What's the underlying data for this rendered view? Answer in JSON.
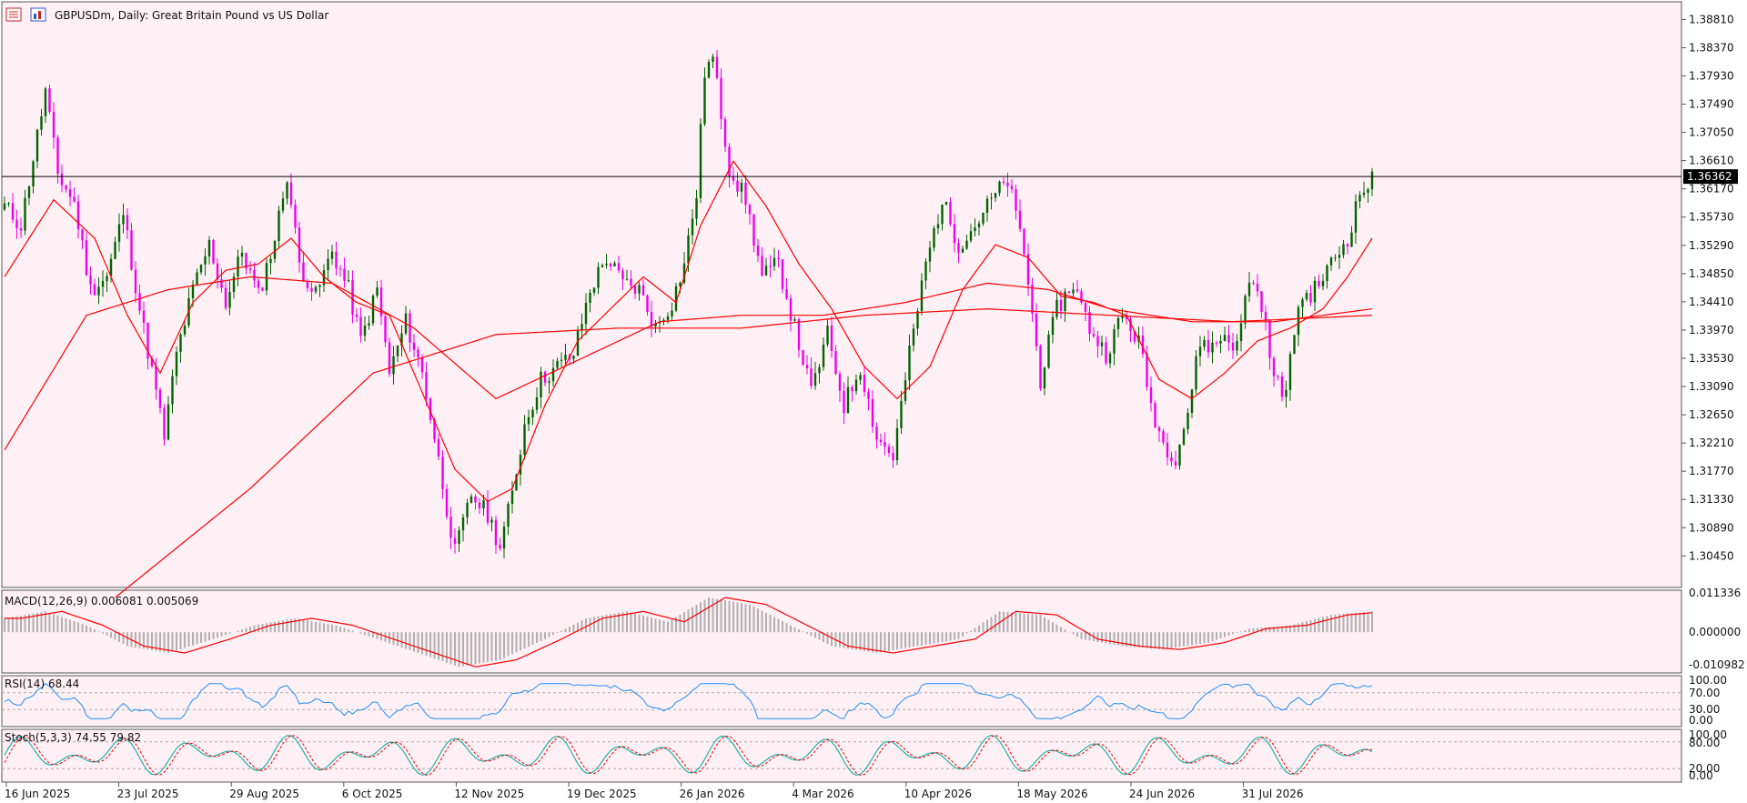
{
  "colors": {
    "background": "#fff0f5",
    "bull": "#006400",
    "bear": "#ee00ee",
    "ma": "#ff0000",
    "rsi": "#1e90ff",
    "stoch_main": "#20b2aa",
    "stoch_signal": "#ff0000",
    "macd_hist": "#b0b0b0",
    "price_tag_bg": "#000000"
  },
  "header": {
    "symbol": "GBPUSDm, Daily:",
    "description": "Great Britain Pound vs US Dollar"
  },
  "toolbar": {
    "icons": [
      "chart-grid-icon",
      "chart-bars-icon"
    ]
  },
  "main_chart": {
    "current_price": "1.36362",
    "y_ticks": [
      "1.38810",
      "1.38370",
      "1.37930",
      "1.37490",
      "1.37050",
      "1.36610",
      "1.36170",
      "1.35730",
      "1.35290",
      "1.34850",
      "1.34410",
      "1.33970",
      "1.33530",
      "1.33090",
      "1.32650",
      "1.32210",
      "1.31770",
      "1.31330",
      "1.30890",
      "1.30450"
    ]
  },
  "macd": {
    "label": "MACD(12,26,9) 0.006081 0.005069",
    "y_ticks": [
      "0.011336",
      "0.000000",
      "-0.010982"
    ]
  },
  "rsi": {
    "label": "RSI(14) 68.44",
    "y_ticks": [
      "100.00",
      "70.00",
      "30.00",
      "0.00"
    ]
  },
  "stoch": {
    "label": "Stoch(5,3,3) 74.55 79.82",
    "y_ticks": [
      "100.00",
      "80.00",
      "20.00",
      "0.00"
    ]
  },
  "x_labels": [
    "16 Jun 2025",
    "23 Jul 2025",
    "29 Aug 2025",
    "6 Oct 2025",
    "12 Nov 2025",
    "19 Dec 2025",
    "26 Jan 2026",
    "4 Mar 2026",
    "10 Apr 2026",
    "18 May 2026",
    "24 Jun 2026",
    "31 Jul 2026"
  ],
  "chart_data": {
    "type": "candlestick",
    "symbol": "GBPUSDm",
    "timeframe": "Daily",
    "y_range": [
      1.301,
      1.39
    ],
    "current_price": 1.36362,
    "anchors": [
      [
        0,
        1.359
      ],
      [
        4,
        1.356
      ],
      [
        8,
        1.37
      ],
      [
        10,
        1.377
      ],
      [
        13,
        1.364
      ],
      [
        17,
        1.3595
      ],
      [
        21,
        1.346
      ],
      [
        25,
        1.348
      ],
      [
        29,
        1.358
      ],
      [
        33,
        1.343
      ],
      [
        37,
        1.33
      ],
      [
        39,
        1.323
      ],
      [
        42,
        1.336
      ],
      [
        46,
        1.346
      ],
      [
        50,
        1.353
      ],
      [
        54,
        1.344
      ],
      [
        58,
        1.352
      ],
      [
        62,
        1.345
      ],
      [
        66,
        1.354
      ],
      [
        69,
        1.364
      ],
      [
        72,
        1.35
      ],
      [
        76,
        1.345
      ],
      [
        80,
        1.352
      ],
      [
        84,
        1.346
      ],
      [
        87,
        1.338
      ],
      [
        91,
        1.346
      ],
      [
        94,
        1.333
      ],
      [
        98,
        1.341
      ],
      [
        102,
        1.333
      ],
      [
        105,
        1.323
      ],
      [
        108,
        1.312
      ],
      [
        110,
        1.305
      ],
      [
        114,
        1.314
      ],
      [
        118,
        1.311
      ],
      [
        121,
        1.306
      ],
      [
        124,
        1.314
      ],
      [
        127,
        1.325
      ],
      [
        131,
        1.332
      ],
      [
        135,
        1.334
      ],
      [
        139,
        1.336
      ],
      [
        143,
        1.346
      ],
      [
        147,
        1.351
      ],
      [
        151,
        1.347
      ],
      [
        155,
        1.346
      ],
      [
        159,
        1.34
      ],
      [
        163,
        1.344
      ],
      [
        166,
        1.35
      ],
      [
        169,
        1.361
      ],
      [
        171,
        1.38
      ],
      [
        173,
        1.382
      ],
      [
        177,
        1.365
      ],
      [
        181,
        1.36
      ],
      [
        185,
        1.348
      ],
      [
        189,
        1.35
      ],
      [
        193,
        1.34
      ],
      [
        197,
        1.33
      ],
      [
        201,
        1.339
      ],
      [
        205,
        1.328
      ],
      [
        209,
        1.334
      ],
      [
        213,
        1.323
      ],
      [
        217,
        1.32
      ],
      [
        221,
        1.336
      ],
      [
        225,
        1.35
      ],
      [
        229,
        1.36
      ],
      [
        233,
        1.353
      ],
      [
        237,
        1.356
      ],
      [
        241,
        1.36
      ],
      [
        245,
        1.363
      ],
      [
        249,
        1.352
      ],
      [
        253,
        1.332
      ],
      [
        257,
        1.343
      ],
      [
        261,
        1.347
      ],
      [
        265,
        1.34
      ],
      [
        269,
        1.336
      ],
      [
        273,
        1.342
      ],
      [
        277,
        1.338
      ],
      [
        280,
        1.328
      ],
      [
        283,
        1.322
      ],
      [
        286,
        1.32
      ],
      [
        289,
        1.327
      ],
      [
        292,
        1.338
      ],
      [
        295,
        1.337
      ],
      [
        298,
        1.339
      ],
      [
        301,
        1.337
      ],
      [
        304,
        1.348
      ],
      [
        307,
        1.344
      ],
      [
        310,
        1.332
      ],
      [
        313,
        1.33
      ],
      [
        316,
        1.344
      ],
      [
        320,
        1.346
      ],
      [
        324,
        1.35
      ],
      [
        328,
        1.354
      ],
      [
        331,
        1.361
      ],
      [
        334,
        1.363
      ]
    ],
    "ma_fast_anchors": [
      [
        0,
        1.348
      ],
      [
        12,
        1.36
      ],
      [
        22,
        1.354
      ],
      [
        30,
        1.342
      ],
      [
        38,
        1.333
      ],
      [
        46,
        1.344
      ],
      [
        54,
        1.349
      ],
      [
        62,
        1.35
      ],
      [
        70,
        1.354
      ],
      [
        78,
        1.348
      ],
      [
        86,
        1.344
      ],
      [
        94,
        1.342
      ],
      [
        102,
        1.33
      ],
      [
        110,
        1.318
      ],
      [
        118,
        1.313
      ],
      [
        124,
        1.315
      ],
      [
        132,
        1.328
      ],
      [
        140,
        1.338
      ],
      [
        148,
        1.343
      ],
      [
        156,
        1.348
      ],
      [
        164,
        1.344
      ],
      [
        170,
        1.356
      ],
      [
        178,
        1.366
      ],
      [
        186,
        1.359
      ],
      [
        194,
        1.35
      ],
      [
        202,
        1.343
      ],
      [
        210,
        1.334
      ],
      [
        218,
        1.329
      ],
      [
        226,
        1.334
      ],
      [
        234,
        1.346
      ],
      [
        242,
        1.353
      ],
      [
        250,
        1.351
      ],
      [
        258,
        1.345
      ],
      [
        266,
        1.344
      ],
      [
        274,
        1.342
      ],
      [
        282,
        1.332
      ],
      [
        290,
        1.329
      ],
      [
        298,
        1.333
      ],
      [
        306,
        1.338
      ],
      [
        314,
        1.34
      ],
      [
        322,
        1.343
      ],
      [
        328,
        1.348
      ],
      [
        334,
        1.354
      ]
    ],
    "ma_mid_anchors": [
      [
        0,
        1.321
      ],
      [
        20,
        1.342
      ],
      [
        40,
        1.346
      ],
      [
        60,
        1.348
      ],
      [
        80,
        1.347
      ],
      [
        100,
        1.34
      ],
      [
        120,
        1.329
      ],
      [
        140,
        1.335
      ],
      [
        160,
        1.341
      ],
      [
        180,
        1.342
      ],
      [
        200,
        1.342
      ],
      [
        220,
        1.344
      ],
      [
        240,
        1.347
      ],
      [
        255,
        1.346
      ],
      [
        270,
        1.343
      ],
      [
        290,
        1.341
      ],
      [
        310,
        1.341
      ],
      [
        334,
        1.343
      ]
    ],
    "ma_slow_anchors": [
      [
        27,
        1.298
      ],
      [
        60,
        1.315
      ],
      [
        90,
        1.333
      ],
      [
        120,
        1.339
      ],
      [
        150,
        1.34
      ],
      [
        180,
        1.34
      ],
      [
        210,
        1.342
      ],
      [
        240,
        1.343
      ],
      [
        270,
        1.342
      ],
      [
        300,
        1.341
      ],
      [
        334,
        1.342
      ]
    ],
    "macd": {
      "hist": [
        0.004,
        0.006,
        0.002,
        -0.004,
        -0.006,
        -0.002,
        0.002,
        0.004,
        0.002,
        -0.002,
        -0.006,
        -0.01,
        -0.008,
        -0.002,
        0.004,
        0.006,
        0.003,
        0.01,
        0.008,
        0.002,
        -0.004,
        -0.006,
        -0.004,
        -0.002,
        0.006,
        0.005,
        -0.002,
        -0.004,
        -0.005,
        -0.003,
        0.001,
        0.002,
        0.005,
        0.006
      ]
    },
    "rsi": {
      "levels": [
        30,
        70
      ]
    },
    "stoch": {
      "levels": [
        20,
        80
      ]
    }
  }
}
